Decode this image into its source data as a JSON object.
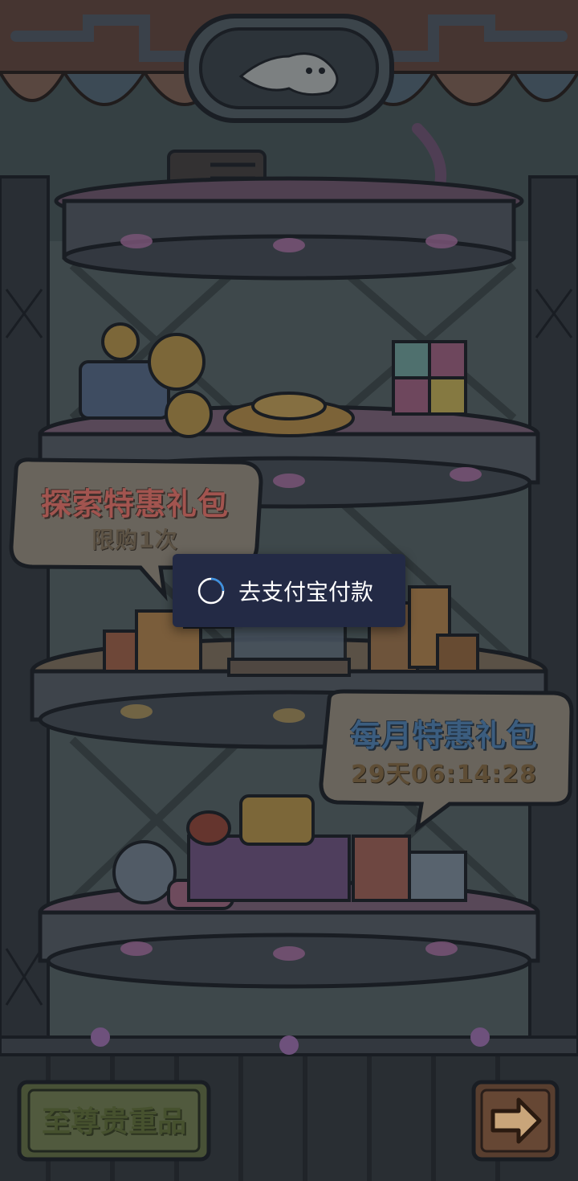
{
  "bundle_explore": {
    "title": "探索特惠礼包",
    "limit": "限购1次"
  },
  "bundle_monthly": {
    "title": "每月特惠礼包",
    "timer": "29天06:14:28"
  },
  "premium_button": {
    "label": "至尊贵重品"
  },
  "next_button": {
    "icon": "arrow-right-icon"
  },
  "toast": {
    "message": "去支付宝付款",
    "icon": "loading-spinner-icon"
  }
}
